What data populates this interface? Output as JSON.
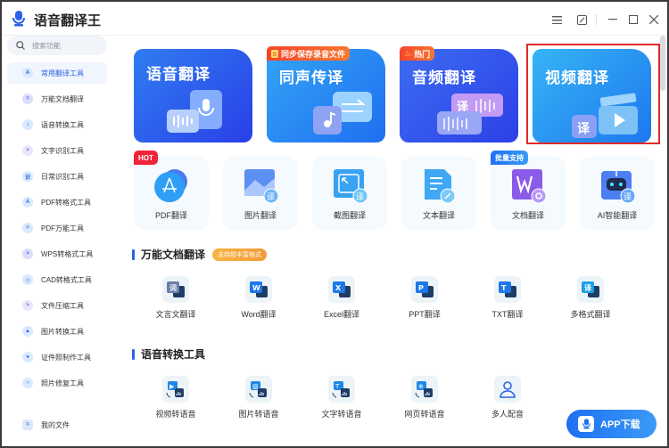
{
  "app": {
    "title": "语音翻译王",
    "logo_icon": "microphone-icon"
  },
  "window_controls": [
    {
      "name": "menu",
      "icon": "hamburger-icon"
    },
    {
      "name": "mini-mode",
      "icon": "resize-icon"
    },
    {
      "name": "minimize",
      "icon": "minimize-icon"
    },
    {
      "name": "maximize",
      "icon": "maximize-icon"
    },
    {
      "name": "close",
      "icon": "close-icon"
    }
  ],
  "sidebar": {
    "search_placeholder": "搜索功能",
    "items": [
      {
        "label": "常用翻译工具",
        "icon": "A",
        "active": true
      },
      {
        "label": "万能文档翻译",
        "icon": "="
      },
      {
        "label": "语音转换工具",
        "icon": "♪"
      },
      {
        "label": "文字识别工具",
        "icon": ">"
      },
      {
        "label": "日常识别工具",
        "icon": "识"
      },
      {
        "label": "PDF转格式工具",
        "icon": "A"
      },
      {
        "label": "PDF万能工具",
        "icon": "="
      },
      {
        "label": "WPS转格式工具",
        "icon": ">"
      },
      {
        "label": "CAD转格式工具",
        "icon": "◇"
      },
      {
        "label": "文件压缩工具",
        "icon": ">"
      },
      {
        "label": "图片转换工具",
        "icon": "▲"
      },
      {
        "label": "证件照制作工具",
        "icon": "●"
      },
      {
        "label": "照片修复工具",
        "icon": "○"
      }
    ],
    "my_files": "我的文件"
  },
  "feature_cards": [
    {
      "title": "语音翻译",
      "badge": ""
    },
    {
      "title": "同声传译",
      "badge": "同步保存录音文件"
    },
    {
      "title": "音频翻译",
      "badge": "热门"
    },
    {
      "title": "视频翻译",
      "badge": "",
      "selected": true
    }
  ],
  "quick_tools": [
    {
      "label": "PDF翻译",
      "badge": "HOT"
    },
    {
      "label": "图片翻译",
      "badge": ""
    },
    {
      "label": "截图翻译",
      "badge": ""
    },
    {
      "label": "文本翻译",
      "badge": ""
    },
    {
      "label": "文档翻译",
      "badge": "批量支持"
    },
    {
      "label": "AI智能翻译",
      "badge": ""
    }
  ],
  "doc_section": {
    "title": "万能文档翻译",
    "tag": "支持超丰富格式",
    "tools": [
      {
        "label": "文言文翻译",
        "glyph": "词",
        "color": "#6b7fa6"
      },
      {
        "label": "Word翻译",
        "glyph": "W",
        "color": "#1e78e8"
      },
      {
        "label": "Excel翻译",
        "glyph": "X",
        "color": "#1e78e8"
      },
      {
        "label": "PPT翻译",
        "glyph": "P",
        "color": "#1e78e8"
      },
      {
        "label": "TXT翻译",
        "glyph": "T",
        "color": "#1e78e8"
      },
      {
        "label": "多格式翻译",
        "glyph": "译",
        "color": "#1ea0e8"
      }
    ]
  },
  "speech_section": {
    "title": "语音转换工具",
    "tools": [
      {
        "label": "视频转语音",
        "glyph": "▶"
      },
      {
        "label": "图片转语音",
        "glyph": "▨"
      },
      {
        "label": "文字转语音",
        "glyph": "T"
      },
      {
        "label": "网页转语音",
        "glyph": "⊕"
      },
      {
        "label": "多人配音",
        "glyph": "👥"
      }
    ]
  },
  "app_download": {
    "label": "APP下载"
  },
  "colors": {
    "accent": "#2a62e8",
    "selection": "#e02a2a",
    "hot": "#f0233a"
  }
}
